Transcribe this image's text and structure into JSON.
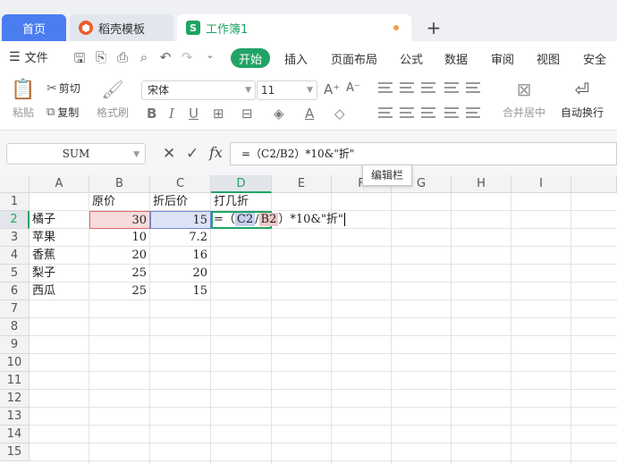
{
  "tabs": {
    "home": "首页",
    "template": "稻壳模板",
    "workbook": "工作簿1",
    "add": "+"
  },
  "menu": {
    "file": "文件",
    "items": [
      "开始",
      "插入",
      "页面布局",
      "公式",
      "数据",
      "审阅",
      "视图",
      "安全"
    ]
  },
  "ribbon": {
    "cut": "剪切",
    "paste": "粘贴",
    "copy": "复制",
    "format_painter": "格式刷",
    "font": "宋体",
    "size": "11",
    "merge": "合并居中",
    "wrap": "自动换行"
  },
  "formula_bar": {
    "name_box": "SUM",
    "formula": "=（C2/B2）*10&\"折\"",
    "tooltip": "编辑栏"
  },
  "columns": [
    "A",
    "B",
    "C",
    "D",
    "E",
    "F",
    "G",
    "H",
    "I"
  ],
  "rows": [
    "1",
    "2",
    "3",
    "4",
    "5",
    "6",
    "7",
    "8",
    "9",
    "10",
    "11",
    "12",
    "13",
    "14",
    "15"
  ],
  "cells": {
    "B1": "原价",
    "C1": "折后价",
    "D1": "打几折",
    "A2": "橘子",
    "B2": "30",
    "C2": "15",
    "A3": "苹果",
    "B3": "10",
    "C3": "7.2",
    "A4": "香蕉",
    "B4": "20",
    "C4": "16",
    "A5": "梨子",
    "B5": "25",
    "C5": "20",
    "A6": "西瓜",
    "B6": "25",
    "C6": "15"
  },
  "d2_edit": {
    "prefix": "=（",
    "ref_c": "C2",
    "slash": "/",
    "ref_b": "B2",
    "suffix": "）*10&\"折\""
  },
  "colors": {
    "accent": "#21a366",
    "home_tab": "#4a7df0",
    "ref_b": "#d96b6b",
    "ref_c": "#6a88d9"
  }
}
